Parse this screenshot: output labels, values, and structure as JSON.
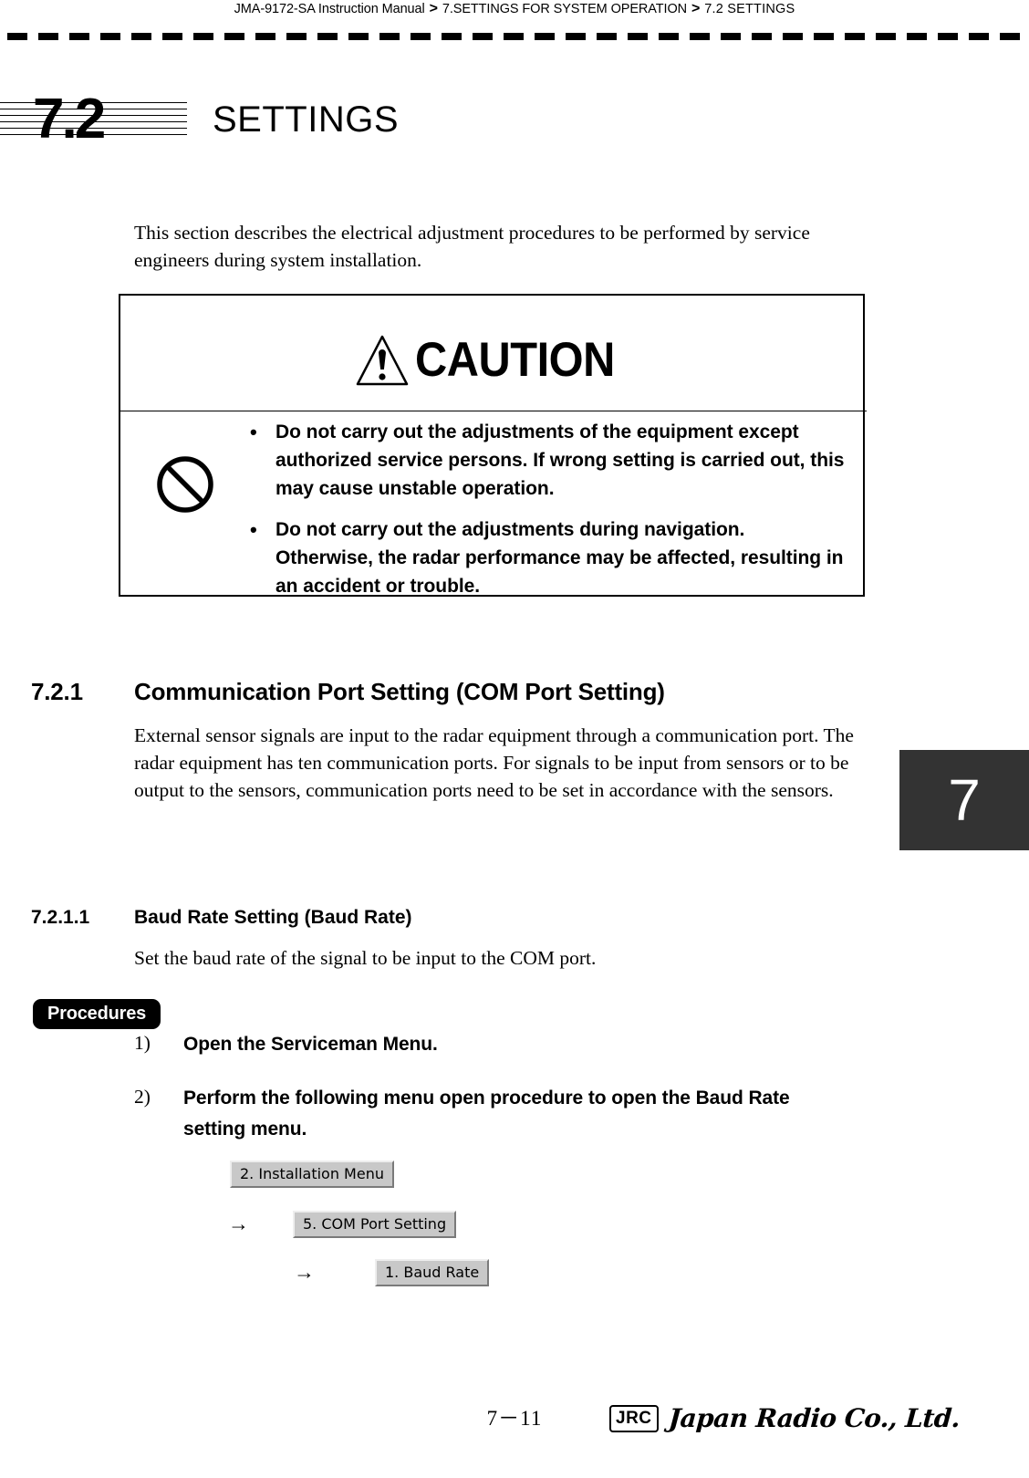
{
  "header": {
    "breadcrumb": [
      "JMA-9172-SA Instruction Manual",
      "7.SETTINGS FOR SYSTEM OPERATION",
      "7.2  SETTINGS"
    ],
    "separator": ">"
  },
  "chapter": {
    "number": "7.2",
    "title": "SETTINGS",
    "tab_label": "7"
  },
  "intro": {
    "paragraph": "This section describes the electrical adjustment procedures to be performed by service engineers during system installation."
  },
  "caution": {
    "title": "CAUTION",
    "warning_icon": "warning-triangle-icon",
    "prohibition_icon": "prohibition-icon",
    "bullet_marker": "•",
    "bullets": [
      "Do not carry out the adjustments of the equipment except authorized service persons. If wrong setting is carried out, this may cause unstable operation.",
      "Do not carry out the adjustments during navigation. Otherwise, the radar performance may be affected, resulting in an accident or trouble."
    ]
  },
  "section_721": {
    "number": "7.2.1",
    "title": "Communication Port Setting (COM Port Setting)",
    "body": "External sensor signals are input to the radar equipment through a communication port. The radar equipment has ten communication ports. For signals to be input from sensors or to be output to the sensors, communication ports need to be set in accordance with the sensors."
  },
  "section_7211": {
    "number": "7.2.1.1",
    "title": "Baud Rate Setting (Baud Rate)",
    "body": "Set the baud rate of the signal to be input to the COM port."
  },
  "procedures": {
    "badge_label": "Procedures",
    "steps": [
      {
        "number": "1)",
        "text": "Open the Serviceman Menu."
      },
      {
        "number": "2)",
        "text": "Perform the following menu open procedure to open the Baud Rate setting menu."
      }
    ],
    "menu_path": [
      {
        "arrow": "",
        "label": "2. Installation Menu"
      },
      {
        "arrow": "→",
        "label": "5. COM Port Setting"
      },
      {
        "arrow": "→",
        "label": "1. Baud Rate"
      }
    ]
  },
  "footer": {
    "page_number": "7－11",
    "logo_mark": "JRC",
    "company_name": "Japan Radio Co., Ltd."
  }
}
